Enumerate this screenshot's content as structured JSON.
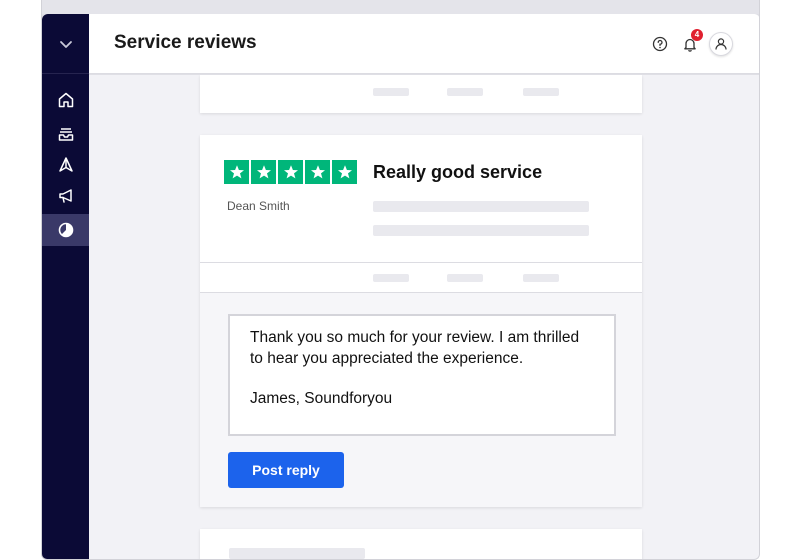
{
  "header": {
    "title": "Service reviews",
    "notification_count": "4"
  },
  "sidebar": {
    "items": [
      {
        "name": "home",
        "icon": "home-icon",
        "active": false
      },
      {
        "name": "inbox",
        "icon": "inbox-tray-icon",
        "active": false
      },
      {
        "name": "navigate",
        "icon": "navigation-arrow-icon",
        "active": false
      },
      {
        "name": "campaigns",
        "icon": "megaphone-icon",
        "active": false
      },
      {
        "name": "analytics",
        "icon": "pie-chart-icon",
        "active": true
      }
    ]
  },
  "review": {
    "rating": 5,
    "title": "Really good service",
    "reviewer": "Dean Smith",
    "star_color": "#00b67a"
  },
  "reply": {
    "text": "Thank you so much for your review. I am thrilled to hear you appreciated the experience.",
    "signature": "James, Soundforyou",
    "button_label": "Post reply",
    "button_color": "#1c63ec"
  },
  "colors": {
    "sidebar_bg": "#0b0a36",
    "accent": "#1c63ec",
    "badge": "#e0202f"
  }
}
